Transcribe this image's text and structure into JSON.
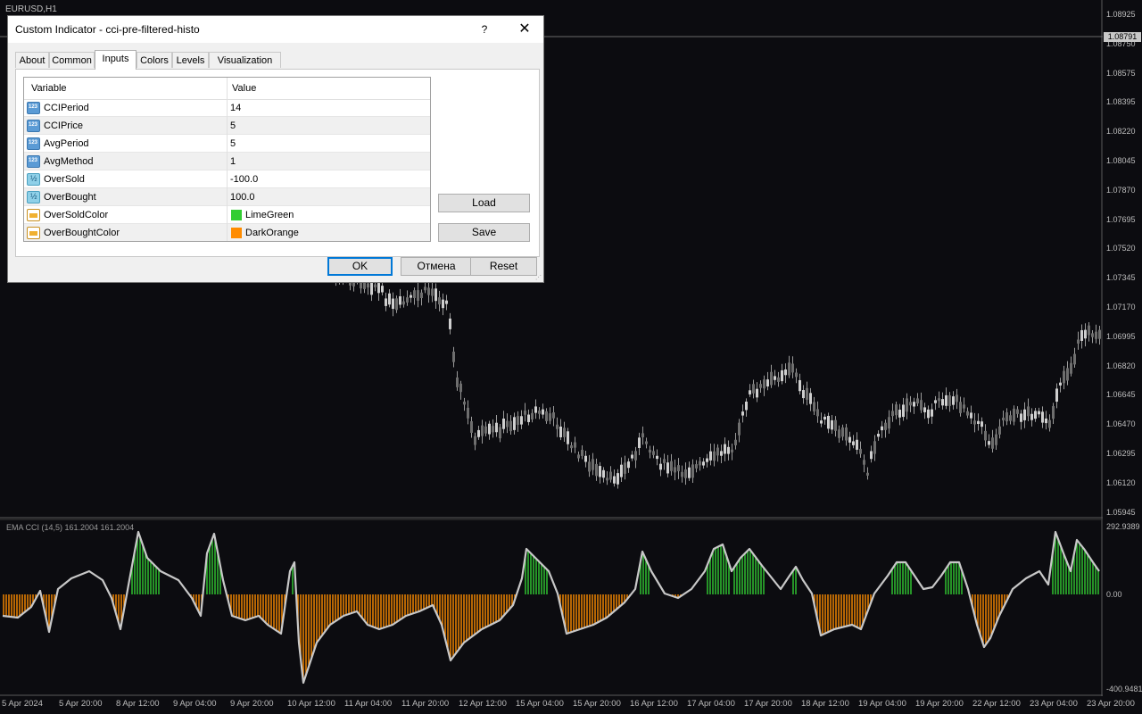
{
  "chart": {
    "symbol": "EURUSD,H1",
    "current_price": "1.08791",
    "price_ticks": [
      "1.08925",
      "1.08750",
      "1.08575",
      "1.08395",
      "1.08220",
      "1.08045",
      "1.07870",
      "1.07695",
      "1.07520",
      "1.07345",
      "1.07170",
      "1.06995",
      "1.06820",
      "1.06645",
      "1.06470",
      "1.06295",
      "1.06120",
      "1.05945"
    ],
    "indicator_label": "EMA CCI (14,5) 161.2004 161.2004",
    "indicator_ticks": [
      "292.9389",
      "0.00",
      "-400.9481"
    ],
    "time_ticks": [
      "5 Apr 2024",
      "5 Apr 20:00",
      "8 Apr 12:00",
      "9 Apr 04:00",
      "9 Apr 20:00",
      "10 Apr 12:00",
      "11 Apr 04:00",
      "11 Apr 20:00",
      "12 Apr 12:00",
      "15 Apr 04:00",
      "15 Apr 20:00",
      "16 Apr 12:00",
      "17 Apr 04:00",
      "17 Apr 20:00",
      "18 Apr 12:00",
      "19 Apr 04:00",
      "19 Apr 20:00",
      "22 Apr 12:00",
      "23 Apr 04:00",
      "23 Apr 20:00"
    ],
    "colors": {
      "background": "#0c0c10",
      "candle": "#9a9a9a",
      "oversold": "#ff8c00",
      "overbought": "#32cd32",
      "line": "#c8c8c8"
    }
  },
  "dialog": {
    "title": "Custom Indicator - cci-pre-filtered-histo",
    "help": "?",
    "close": "✕",
    "tabs": [
      "About",
      "Common",
      "Inputs",
      "Colors",
      "Levels",
      "Visualization"
    ],
    "active_tab": "Inputs",
    "columns": [
      "Variable",
      "Value"
    ],
    "rows": [
      {
        "icon": "num",
        "name": "CCIPeriod",
        "value": "14"
      },
      {
        "icon": "num",
        "name": "CCIPrice",
        "value": "5"
      },
      {
        "icon": "num",
        "name": "AvgPeriod",
        "value": "5"
      },
      {
        "icon": "num",
        "name": "AvgMethod",
        "value": "1"
      },
      {
        "icon": "dbl",
        "name": "OverSold",
        "value": "-100.0"
      },
      {
        "icon": "dbl",
        "name": "OverBought",
        "value": "100.0"
      },
      {
        "icon": "col",
        "name": "OverSoldColor",
        "value": "LimeGreen",
        "swatch": "#32cd32"
      },
      {
        "icon": "col",
        "name": "OverBoughtColor",
        "value": "DarkOrange",
        "swatch": "#ff8c00"
      }
    ],
    "load": "Load",
    "save": "Save",
    "ok": "OK",
    "cancel": "Отмена",
    "reset": "Reset"
  }
}
